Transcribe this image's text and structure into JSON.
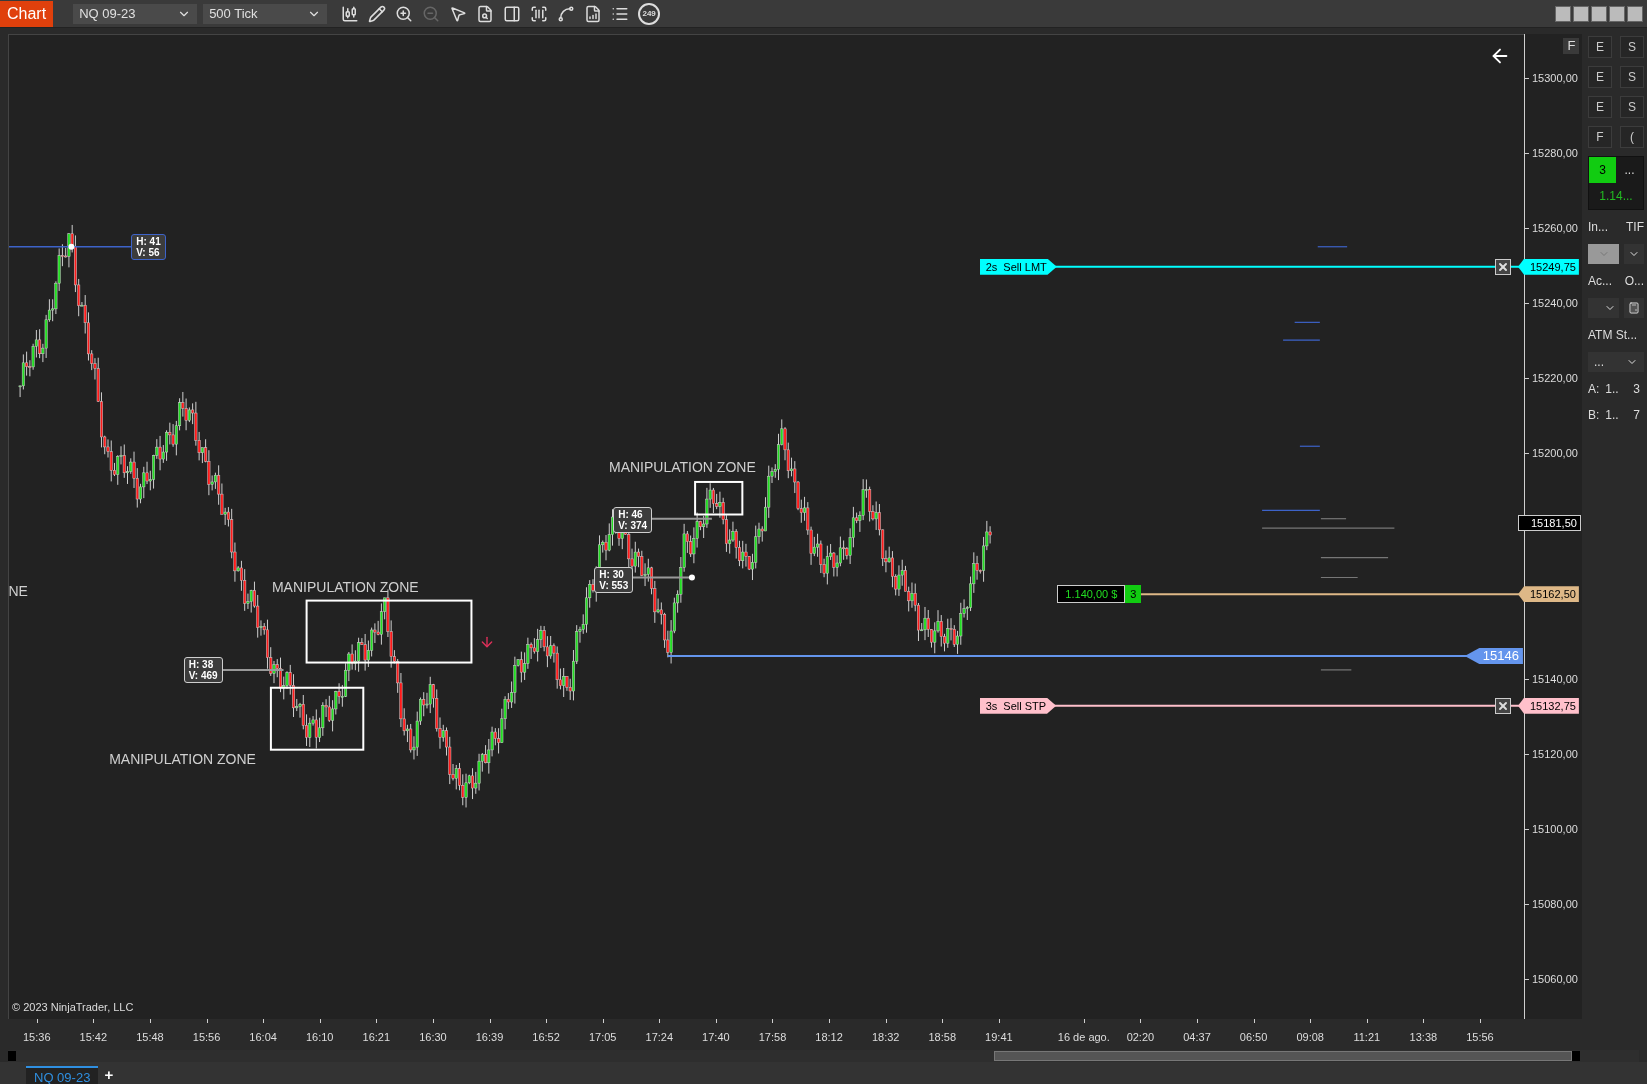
{
  "toolbar": {
    "app_label": "Chart",
    "instrument": "NQ 09-23",
    "interval": "500 Tick",
    "badge": "249"
  },
  "chart": {
    "flag_button": "F",
    "copyright": "© 2023 NinjaTrader, LLC",
    "annotations": [
      {
        "kind": "text",
        "text": "NE"
      },
      {
        "kind": "text",
        "text": "MANIPULATION ZONE"
      },
      {
        "kind": "text",
        "text": "MANIPULATION ZONE"
      },
      {
        "kind": "text",
        "text": "MANIPULATION ZONE"
      },
      {
        "kind": "info",
        "lines": [
          "H: 41",
          "V: 56"
        ],
        "color": "#3d63c9"
      },
      {
        "kind": "info",
        "lines": [
          "H: 38",
          "V: 469"
        ],
        "color": "#cfcfcf"
      },
      {
        "kind": "info",
        "lines": [
          "H: 46",
          "V: 374"
        ],
        "color": "#cfcfcf"
      },
      {
        "kind": "info",
        "lines": [
          "H: 30",
          "V: 553"
        ],
        "color": "#cfcfcf"
      }
    ],
    "price_axis": [
      "15300,00",
      "15280,00",
      "15260,00",
      "15240,00",
      "15220,00",
      "15200,00",
      "15140,00",
      "15120,00",
      "15100,00",
      "15080,00",
      "15060,00"
    ],
    "time_axis": [
      "15:36",
      "15:42",
      "15:48",
      "15:56",
      "16:04",
      "16:10",
      "16:21",
      "16:30",
      "16:39",
      "16:52",
      "17:05",
      "17:24",
      "17:40",
      "17:58",
      "18:12",
      "18:32",
      "18:58",
      "19:41",
      "16 de ago.",
      "02:20",
      "04:37",
      "06:50",
      "09:08",
      "11:21",
      "13:38",
      "15:56"
    ],
    "orders": [
      {
        "kind": "order",
        "text": "2s  Sell LMT",
        "price": "15249,75",
        "color": "#00ffff"
      },
      {
        "kind": "position",
        "pnl": "1.140,00 $",
        "qty": "3",
        "price": "15162,50",
        "color": "#deb887"
      },
      {
        "kind": "order",
        "text": "3s  Sell STP",
        "price": "15132,75",
        "color": "#ffc0cb"
      }
    ],
    "price_line": {
      "label": "15146",
      "color": "#6495ed"
    },
    "last_price": "15181,50"
  },
  "right_panel": {
    "buttons": [
      "E",
      "S",
      "E",
      "S",
      "E",
      "S",
      "F",
      "("
    ],
    "position_qty": "3",
    "position_more": "...",
    "pnl": "1.14...",
    "labels": [
      "In...",
      "TIF"
    ],
    "labels_2": [
      "Ac...",
      "O..."
    ],
    "atm_label": "ATM St...",
    "atm_value": "...",
    "ask": [
      "A:",
      "1..",
      "3"
    ],
    "bid": [
      "B:",
      "1..",
      "7"
    ]
  },
  "tabs": [
    {
      "label": "NQ 09-23",
      "selected": true
    }
  ],
  "add_tab": "+"
}
